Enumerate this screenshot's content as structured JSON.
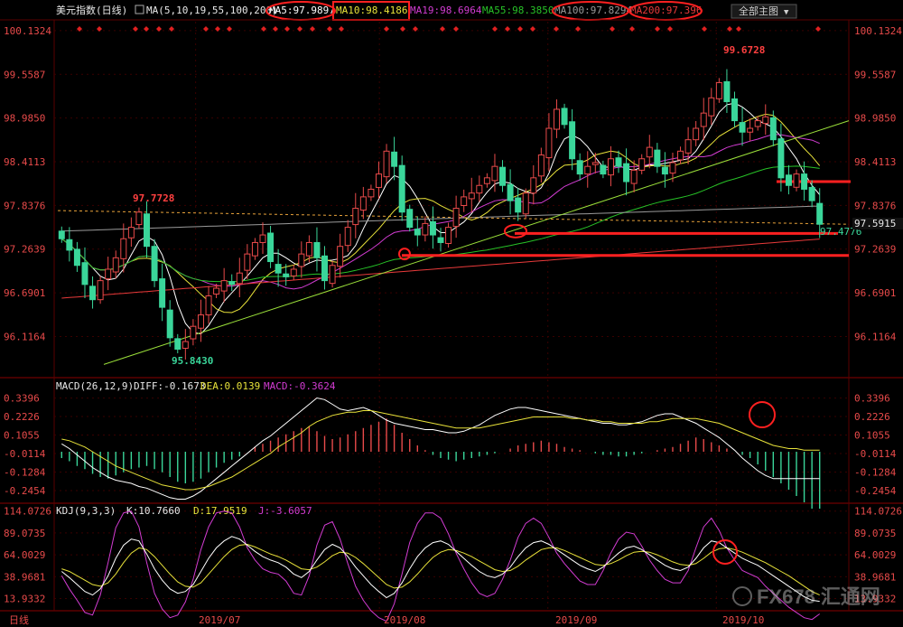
{
  "header": {
    "symbol": "美元指数(日线)",
    "ma_params": "MA(5,10,19,55,100,200)",
    "ma_values": [
      {
        "label": "MA5:97.9897",
        "color": "#ffffff"
      },
      {
        "label": "MA10:98.4186",
        "color": "#e8e23a"
      },
      {
        "label": "MA19:98.6964",
        "color": "#d23cd2"
      },
      {
        "label": "MA55:98.3850",
        "color": "#27c227"
      },
      {
        "label": "MA100:97.8294",
        "color": "#9a9a9a"
      },
      {
        "label": "MA200:97.396",
        "color": "#e83a3a"
      }
    ],
    "theme_button": "全部主图",
    "theme_arrow": "▼"
  },
  "colors": {
    "bg": "#000000",
    "grid": "#3a0000",
    "up": "#e84a4a",
    "down": "#3ad69a",
    "axis_text": "#e84a4a",
    "annot": "#ff2020",
    "trend": "#9be03a"
  },
  "main_axis_labels": [
    "100.1324",
    "99.5587",
    "98.9850",
    "98.4113",
    "97.8376",
    "97.2639",
    "96.6901",
    "96.1164"
  ],
  "price_tags": [
    {
      "text": "97.5915",
      "color": "#e8e8e8"
    },
    {
      "text": "97.4776",
      "color": "#3ad69a"
    }
  ],
  "extreme_labels": [
    {
      "text": "99.6728",
      "color": "#ff4040"
    },
    {
      "text": "97.7728",
      "color": "#ff4040"
    },
    {
      "text": "95.8430",
      "color": "#3ad69a"
    }
  ],
  "macd": {
    "title": "MACD(26,12,9)",
    "diff": "DIFF:-0.1673",
    "dea": "DEA:0.0139",
    "macd": "MACD:-0.3624",
    "axis_labels": [
      "0.3396",
      "0.2226",
      "0.1055",
      "-0.0114",
      "-0.1284",
      "-0.2454"
    ]
  },
  "kdj": {
    "title": "KDJ(9,3,3)",
    "k": "K:10.7660",
    "d": "D:17.9519",
    "j": "J:-3.6057",
    "axis_labels": [
      "114.0726",
      "89.0735",
      "64.0029",
      "38.9681",
      "13.9332"
    ]
  },
  "x_axis": {
    "period_label": "日线",
    "months": [
      "2019/07",
      "2019/08",
      "2019/09",
      "2019/10"
    ]
  },
  "watermark": "FX678 汇通网",
  "chart_data": {
    "type": "candlestick",
    "title": "美元指数(日线)",
    "ylim": [
      95.6,
      100.25
    ],
    "y_ticks": [
      100.1324,
      99.5587,
      98.985,
      98.4113,
      97.8376,
      97.2639,
      96.6901,
      96.1164
    ],
    "ma_last": {
      "MA5": 97.9897,
      "MA10": 98.4186,
      "MA19": 98.6964,
      "MA55": 98.385,
      "MA100": 97.8294,
      "MA200": 97.396
    },
    "high": 99.6728,
    "low": 95.843,
    "marked_price_high": 97.7728,
    "current_price": 97.5915,
    "current_low": 97.4776,
    "macd_params": [
      26,
      12,
      9
    ],
    "macd_last": {
      "DIFF": -0.1673,
      "DEA": 0.0139,
      "MACD": -0.3624
    },
    "macd_ylim": [
      -0.32,
      0.4
    ],
    "kdj_params": [
      9,
      3,
      3
    ],
    "kdj_last": {
      "K": 10.766,
      "D": 17.9519,
      "J": -3.6057
    },
    "kdj_ylim": [
      0,
      120
    ],
    "closes": [
      97.4,
      97.25,
      97.05,
      96.8,
      96.6,
      96.85,
      97.0,
      97.15,
      97.4,
      97.55,
      97.75,
      97.3,
      96.85,
      96.5,
      96.1,
      95.95,
      96.05,
      96.25,
      96.4,
      96.65,
      96.75,
      96.85,
      96.8,
      96.95,
      97.2,
      97.35,
      97.45,
      97.1,
      96.95,
      96.9,
      97.0,
      97.2,
      97.35,
      97.15,
      96.85,
      97.05,
      97.3,
      97.55,
      97.8,
      97.95,
      98.05,
      98.25,
      98.55,
      98.35,
      97.75,
      97.55,
      97.45,
      97.6,
      97.45,
      97.35,
      97.55,
      97.8,
      97.95,
      98.0,
      98.1,
      98.2,
      98.35,
      98.1,
      97.9,
      97.75,
      98.0,
      98.2,
      98.5,
      98.85,
      99.1,
      98.9,
      98.45,
      98.25,
      98.35,
      98.4,
      98.25,
      98.45,
      98.35,
      98.15,
      98.3,
      98.45,
      98.6,
      98.35,
      98.25,
      98.4,
      98.55,
      98.7,
      98.85,
      99.05,
      99.25,
      99.45,
      99.2,
      98.95,
      98.8,
      98.85,
      98.95,
      99.0,
      98.7,
      98.2,
      98.1,
      98.25,
      98.05,
      97.9,
      97.59
    ],
    "macd_hist": [
      -0.04,
      -0.06,
      -0.09,
      -0.11,
      -0.14,
      -0.16,
      -0.17,
      -0.15,
      -0.13,
      -0.11,
      -0.1,
      -0.09,
      -0.11,
      -0.13,
      -0.16,
      -0.19,
      -0.2,
      -0.19,
      -0.17,
      -0.13,
      -0.1,
      -0.07,
      -0.05,
      -0.03,
      0.0,
      0.03,
      0.05,
      0.07,
      0.09,
      0.11,
      0.13,
      0.15,
      0.16,
      0.13,
      0.1,
      0.08,
      0.09,
      0.11,
      0.13,
      0.15,
      0.17,
      0.19,
      0.21,
      0.17,
      0.12,
      0.08,
      0.04,
      0.01,
      -0.02,
      -0.04,
      -0.05,
      -0.06,
      -0.05,
      -0.04,
      -0.03,
      -0.02,
      -0.01,
      0.0,
      0.02,
      0.04,
      0.05,
      0.06,
      0.07,
      0.06,
      0.05,
      0.03,
      0.02,
      0.01,
      0.0,
      -0.01,
      -0.02,
      -0.02,
      -0.03,
      -0.03,
      -0.02,
      -0.01,
      0.0,
      0.01,
      0.02,
      0.03,
      0.05,
      0.07,
      0.09,
      0.08,
      0.06,
      0.04,
      0.02,
      0.0,
      -0.02,
      -0.04,
      -0.08,
      -0.12,
      -0.16,
      -0.2,
      -0.24,
      -0.28,
      -0.32,
      -0.36,
      -0.36
    ],
    "macd_diff": [
      0.05,
      0.02,
      -0.02,
      -0.06,
      -0.1,
      -0.13,
      -0.16,
      -0.18,
      -0.19,
      -0.2,
      -0.22,
      -0.23,
      -0.25,
      -0.27,
      -0.29,
      -0.3,
      -0.3,
      -0.28,
      -0.25,
      -0.21,
      -0.17,
      -0.13,
      -0.09,
      -0.05,
      -0.01,
      0.03,
      0.07,
      0.1,
      0.14,
      0.18,
      0.22,
      0.26,
      0.3,
      0.34,
      0.33,
      0.3,
      0.27,
      0.26,
      0.27,
      0.28,
      0.26,
      0.23,
      0.2,
      0.18,
      0.17,
      0.16,
      0.15,
      0.14,
      0.14,
      0.13,
      0.12,
      0.12,
      0.13,
      0.15,
      0.17,
      0.2,
      0.23,
      0.25,
      0.27,
      0.28,
      0.28,
      0.27,
      0.26,
      0.25,
      0.24,
      0.23,
      0.22,
      0.21,
      0.2,
      0.19,
      0.18,
      0.18,
      0.17,
      0.17,
      0.18,
      0.19,
      0.21,
      0.23,
      0.24,
      0.24,
      0.22,
      0.2,
      0.18,
      0.15,
      0.12,
      0.09,
      0.05,
      0.01,
      -0.04,
      -0.08,
      -0.12,
      -0.15,
      -0.17,
      -0.17,
      -0.17,
      -0.17,
      -0.17,
      -0.17,
      -0.17
    ],
    "macd_dea": [
      0.08,
      0.07,
      0.05,
      0.03,
      0.0,
      -0.03,
      -0.06,
      -0.09,
      -0.11,
      -0.13,
      -0.15,
      -0.17,
      -0.19,
      -0.21,
      -0.22,
      -0.23,
      -0.24,
      -0.24,
      -0.23,
      -0.22,
      -0.2,
      -0.18,
      -0.16,
      -0.13,
      -0.1,
      -0.07,
      -0.04,
      -0.01,
      0.03,
      0.06,
      0.09,
      0.12,
      0.16,
      0.19,
      0.21,
      0.23,
      0.24,
      0.25,
      0.25,
      0.26,
      0.26,
      0.25,
      0.24,
      0.23,
      0.22,
      0.21,
      0.2,
      0.19,
      0.18,
      0.17,
      0.16,
      0.15,
      0.15,
      0.15,
      0.15,
      0.16,
      0.17,
      0.18,
      0.19,
      0.2,
      0.21,
      0.22,
      0.22,
      0.22,
      0.22,
      0.22,
      0.21,
      0.21,
      0.2,
      0.2,
      0.19,
      0.19,
      0.18,
      0.18,
      0.18,
      0.18,
      0.19,
      0.19,
      0.2,
      0.21,
      0.21,
      0.21,
      0.21,
      0.2,
      0.19,
      0.18,
      0.16,
      0.14,
      0.12,
      0.1,
      0.08,
      0.06,
      0.04,
      0.03,
      0.02,
      0.02,
      0.01,
      0.01,
      0.01
    ],
    "kdj_k": [
      45,
      38,
      30,
      22,
      18,
      25,
      40,
      60,
      75,
      82,
      80,
      65,
      48,
      35,
      25,
      20,
      22,
      30,
      45,
      60,
      72,
      80,
      85,
      82,
      75,
      68,
      62,
      58,
      55,
      50,
      42,
      38,
      45,
      58,
      70,
      76,
      72,
      62,
      50,
      40,
      30,
      22,
      15,
      20,
      32,
      48,
      62,
      72,
      78,
      80,
      76,
      68,
      60,
      52,
      45,
      40,
      38,
      42,
      50,
      62,
      72,
      78,
      80,
      76,
      70,
      64,
      58,
      52,
      48,
      45,
      50,
      58,
      66,
      72,
      74,
      70,
      64,
      58,
      52,
      48,
      46,
      50,
      60,
      72,
      80,
      78,
      72,
      66,
      60,
      56,
      52,
      46,
      40,
      34,
      28,
      22,
      16,
      12,
      10.8
    ],
    "kdj_d": [
      48,
      45,
      40,
      35,
      30,
      28,
      32,
      42,
      55,
      66,
      72,
      70,
      62,
      52,
      42,
      33,
      28,
      27,
      32,
      42,
      52,
      62,
      70,
      75,
      76,
      73,
      69,
      65,
      62,
      58,
      53,
      48,
      47,
      50,
      56,
      63,
      67,
      66,
      61,
      54,
      46,
      38,
      30,
      26,
      27,
      33,
      42,
      52,
      61,
      67,
      70,
      69,
      66,
      62,
      57,
      52,
      47,
      45,
      46,
      51,
      58,
      64,
      70,
      72,
      72,
      69,
      65,
      61,
      57,
      53,
      52,
      54,
      58,
      63,
      67,
      68,
      67,
      64,
      60,
      56,
      53,
      52,
      54,
      60,
      67,
      71,
      72,
      70,
      67,
      63,
      59,
      55,
      50,
      45,
      40,
      34,
      28,
      22,
      17.95
    ],
    "kdj_j": [
      40,
      25,
      12,
      -2,
      -5,
      18,
      55,
      95,
      112,
      114,
      96,
      55,
      20,
      2,
      -8,
      -5,
      10,
      36,
      70,
      96,
      112,
      114,
      112,
      96,
      72,
      58,
      48,
      44,
      42,
      34,
      20,
      18,
      40,
      75,
      98,
      102,
      82,
      54,
      28,
      12,
      0,
      -8,
      -12,
      8,
      42,
      78,
      100,
      112,
      112,
      106,
      88,
      66,
      48,
      32,
      20,
      16,
      20,
      36,
      58,
      84,
      100,
      106,
      100,
      84,
      66,
      54,
      44,
      34,
      30,
      30,
      46,
      66,
      82,
      90,
      88,
      74,
      58,
      46,
      36,
      32,
      32,
      46,
      72,
      96,
      106,
      92,
      72,
      58,
      46,
      42,
      38,
      28,
      20,
      12,
      4,
      -2,
      -8,
      -10,
      -3.6
    ]
  }
}
